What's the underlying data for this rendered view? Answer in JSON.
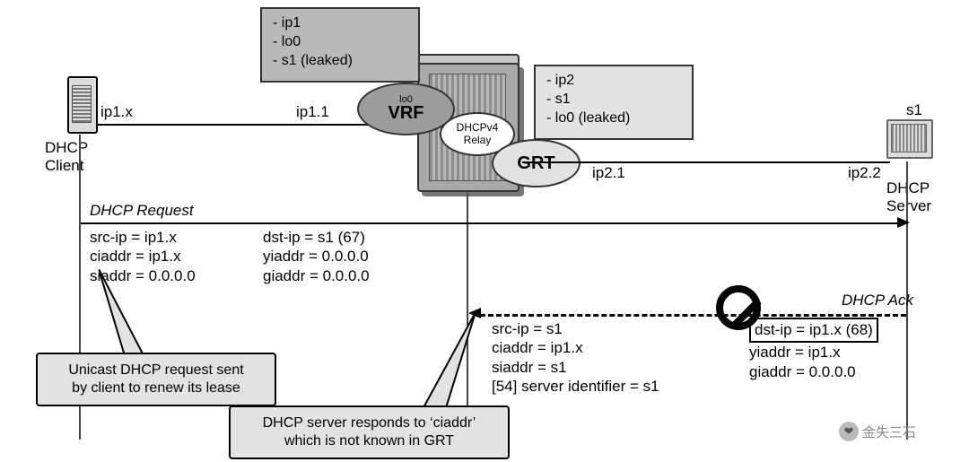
{
  "devices": {
    "client": {
      "title1": "DHCP",
      "title2": "Client",
      "ip": "ip1.x"
    },
    "server": {
      "title1": "DHCP",
      "title2": "Server",
      "name": "s1",
      "ip": "ip2.2"
    },
    "router": {
      "vrf_label": "VRF",
      "grt_label": "GRT",
      "relay_label1": "DHCPv4",
      "relay_label2": "Relay",
      "lo0_label": "lo0",
      "left_ip": "ip1.1",
      "right_ip": "ip2.1"
    }
  },
  "infoboxes": {
    "vrf_routes": {
      "l1": "- ip1",
      "l2": "- lo0",
      "l3": "- s1 (leaked)"
    },
    "grt_routes": {
      "l1": "- ip2",
      "l2": "- s1",
      "l3": "- lo0 (leaked)"
    }
  },
  "seq": {
    "req_title": "DHCP Request",
    "req": {
      "c1l1": "src-ip = ip1.x",
      "c1l2": "ciaddr = ip1.x",
      "c1l3": "siaddr = 0.0.0.0",
      "c2l1": "dst-ip = s1 (67)",
      "c2l2": "yiaddr = 0.0.0.0",
      "c2l3": "giaddr = 0.0.0.0"
    },
    "ack_title": "DHCP Ack",
    "ack": {
      "c1l1": "src-ip = s1",
      "c1l2": "ciaddr = ip1.x",
      "c1l3": "siaddr = s1",
      "c1l4": "[54] server identifier = s1",
      "c2l1": "dst-ip = ip1.x (68)",
      "c2l2": "yiaddr = ip1.x",
      "c2l3": "giaddr = 0.0.0.0"
    }
  },
  "callouts": {
    "client_note_l1": "Unicast DHCP request sent",
    "client_note_l2": "by client to renew its lease",
    "server_note_l1": "DHCP server responds to ‘ciaddr’",
    "server_note_l2": "which is not known in GRT"
  },
  "watermark": {
    "text": "金失三石",
    "icon": "👁"
  }
}
